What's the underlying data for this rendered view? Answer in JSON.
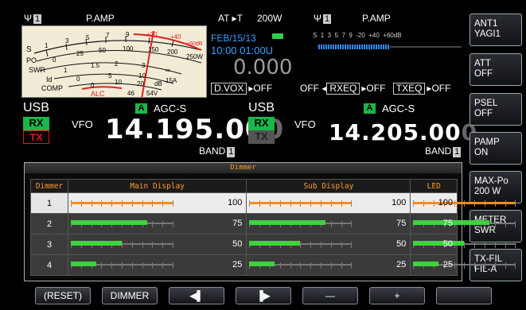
{
  "left_vfo": {
    "antenna_label": "Ψ",
    "antenna_num": "1",
    "pamp": "P.AMP",
    "mode": "USB",
    "agc": "AGC-S",
    "agc_badge": "A",
    "rx": "RX",
    "tx": "TX",
    "vfo": "VFO",
    "freq_main": "14.195.00",
    "freq_dim": "0",
    "band": "BAND",
    "band_num": "1"
  },
  "center": {
    "at": "AT ▸T",
    "power": "200W",
    "date": "FEB/15/13",
    "time": "10:00 01:00U",
    "counter": "0.000",
    "dvox": "D.VOX",
    "dvox_state": "▸OFF"
  },
  "right_vfo": {
    "antenna_label": "Ψ",
    "antenna_num": "1",
    "pamp": "P.AMP",
    "mode": "USB",
    "agc": "AGC-S",
    "agc_badge": "A",
    "rx": "RX",
    "tx": "TX",
    "vfo": "VFO",
    "freq_main": "14.205.00",
    "freq_dim": "0",
    "band": "BAND",
    "band_num": "1",
    "rxeq_prefix": "OFF ◂",
    "rxeq": "RXEQ",
    "rxeq_state": "▸OFF",
    "txeq": "TXEQ",
    "txeq_state": "▸OFF",
    "s_meter_scale": "S  1  3  5  7  9  -20  +40  +60dB"
  },
  "meter": {
    "row_s": "S",
    "row_po": "PO",
    "row_swr": "SWR",
    "row_id": "Id",
    "row_comp": "COMP",
    "alc": "ALC",
    "scale_s": [
      "1",
      "3",
      "5",
      "7",
      "9",
      "+20",
      "+40",
      "+60dB"
    ],
    "scale_po": [
      "0",
      "25",
      "50",
      "100",
      "150",
      "200",
      "250W"
    ],
    "scale_swr": [
      "1",
      "1.5",
      "2",
      "3",
      "∞"
    ],
    "scale_id": [
      "0",
      "5",
      "10",
      "15A"
    ],
    "scale_comp": [
      "0",
      "10",
      "20",
      "dB"
    ],
    "scale_comp2": [
      "46",
      "54V"
    ]
  },
  "side_buttons": [
    {
      "label1": "ANT1",
      "label2": "YAGI1"
    },
    {
      "label1": "ATT",
      "label2": "OFF"
    },
    {
      "label1": "PSEL",
      "label2": "OFF"
    },
    {
      "label1": "PAMP",
      "label2": "ON"
    },
    {
      "label1": "MAX-Po",
      "label2": "200 W"
    },
    {
      "label1": "METER",
      "label2": "SWR"
    },
    {
      "label1": "TX-FIL",
      "label2": "FIL-A"
    }
  ],
  "bottom_buttons": [
    {
      "label": "(RESET)"
    },
    {
      "label": "DIMMER"
    },
    {
      "label": "◀▌"
    },
    {
      "label": "▐▶"
    },
    {
      "label": "—"
    },
    {
      "label": "+"
    },
    {
      "label": ""
    }
  ],
  "dimmer": {
    "title": "Dimmer",
    "headers": [
      "Dimmer",
      "Main Display",
      "Sub Display",
      "LED"
    ],
    "rows": [
      {
        "num": "1",
        "main": 100,
        "sub": 100,
        "led": 100
      },
      {
        "num": "2",
        "main": 75,
        "sub": 75,
        "led": 75
      },
      {
        "num": "3",
        "main": 50,
        "sub": 50,
        "led": 50
      },
      {
        "num": "4",
        "main": 25,
        "sub": 25,
        "led": 25
      }
    ],
    "selected_row": 0
  },
  "colors": {
    "rx_green": "#19b84a",
    "tx_red": "#e01818",
    "accent_orange": "#ff9a2a",
    "bar_green": "#3fd23f",
    "bar_orange": "#ff8c1a",
    "time_blue": "#3aa0ff"
  }
}
